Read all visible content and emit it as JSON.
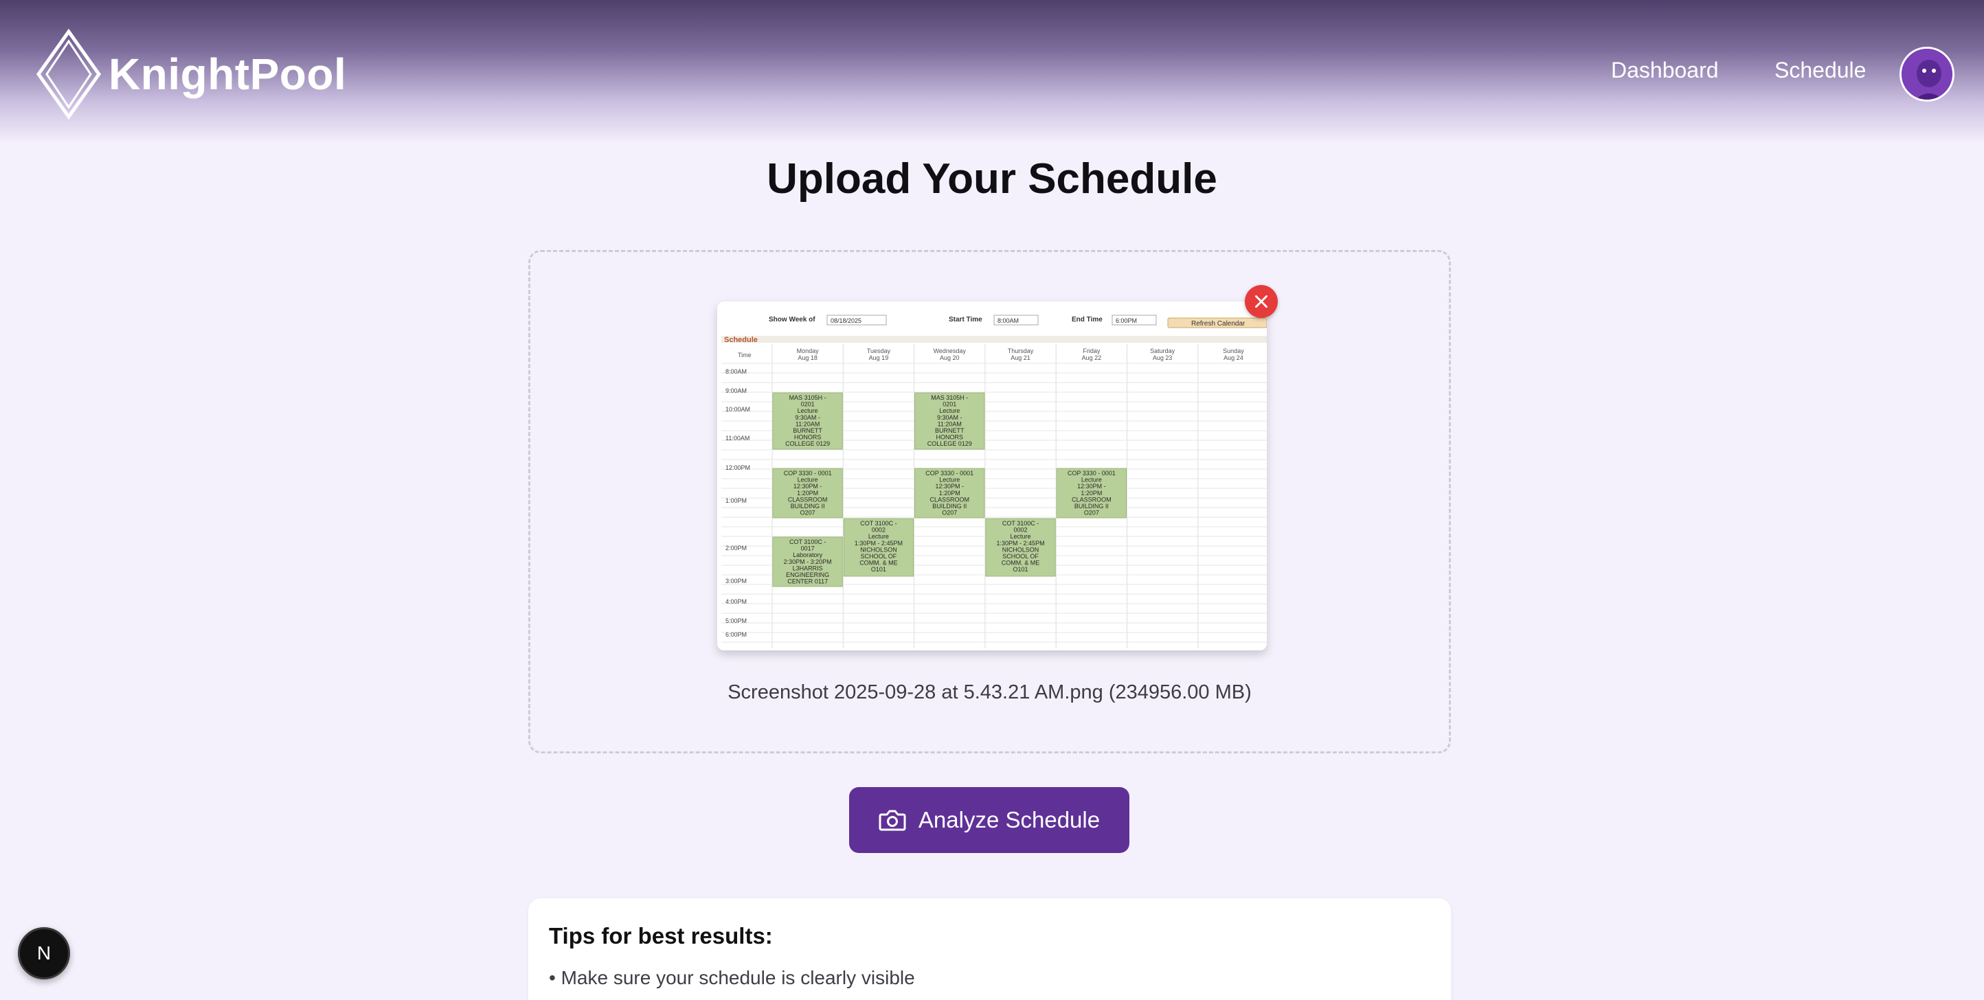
{
  "brand": {
    "name": "KnightPool",
    "logo_icon": "diamond-icon"
  },
  "nav": {
    "dashboard": "Dashboard",
    "schedule": "Schedule"
  },
  "page": {
    "title": "Upload Your Schedule"
  },
  "upload": {
    "file_name": "Screenshot 2025-09-28 at 5.43.21 AM.png (234956.00 MB)",
    "remove_icon": "close-icon"
  },
  "actions": {
    "analyze_label": "Analyze Schedule",
    "analyze_icon": "camera-icon"
  },
  "tips": {
    "title": "Tips for best results:",
    "items": [
      "• Make sure your schedule is clearly visible"
    ]
  },
  "preview_schedule": {
    "show_week_label": "Show Week of",
    "week_value": "08/18/2025",
    "start_time_label": "Start Time",
    "start_time_value": "8:00AM",
    "end_time_label": "End Time",
    "end_time_value": "6:00PM",
    "refresh_label": "Refresh Calendar",
    "section_label": "Schedule",
    "time_header": "Time",
    "days": [
      [
        "Monday",
        "Aug 18"
      ],
      [
        "Tuesday",
        "Aug 19"
      ],
      [
        "Wednesday",
        "Aug 20"
      ],
      [
        "Thursday",
        "Aug 21"
      ],
      [
        "Friday",
        "Aug 22"
      ],
      [
        "Saturday",
        "Aug 23"
      ],
      [
        "Sunday",
        "Aug 24"
      ]
    ],
    "times": [
      "8:00AM",
      "9:00AM",
      "10:00AM",
      "11:00AM",
      "12:00PM",
      "1:00PM",
      "2:00PM",
      "3:00PM",
      "4:00PM",
      "5:00PM",
      "6:00PM"
    ],
    "events": [
      {
        "day": 0,
        "lines": [
          "MAS 3105H -",
          "0201",
          "Lecture",
          "9:30AM -",
          "11:20AM",
          "BURNETT",
          "HONORS",
          "COLLEGE 0129"
        ]
      },
      {
        "day": 2,
        "lines": [
          "MAS 3105H -",
          "0201",
          "Lecture",
          "9:30AM -",
          "11:20AM",
          "BURNETT",
          "HONORS",
          "COLLEGE 0129"
        ]
      },
      {
        "day": 0,
        "lines": [
          "COP 3330 - 0001",
          "Lecture",
          "12:30PM -",
          "1:20PM",
          "CLASSROOM",
          "BUILDING II",
          "O207"
        ]
      },
      {
        "day": 2,
        "lines": [
          "COP 3330 - 0001",
          "Lecture",
          "12:30PM -",
          "1:20PM",
          "CLASSROOM",
          "BUILDING II",
          "O207"
        ]
      },
      {
        "day": 4,
        "lines": [
          "COP 3330 - 0001",
          "Lecture",
          "12:30PM -",
          "1:20PM",
          "CLASSROOM",
          "BUILDING II",
          "O207"
        ]
      },
      {
        "day": 1,
        "lines": [
          "COT 3100C -",
          "0002",
          "Lecture",
          "1:30PM - 2:45PM",
          "NICHOLSON",
          "SCHOOL OF",
          "COMM. & ME",
          "O101"
        ]
      },
      {
        "day": 3,
        "lines": [
          "COT 3100C -",
          "0002",
          "Lecture",
          "1:30PM - 2:45PM",
          "NICHOLSON",
          "SCHOOL OF",
          "COMM. & ME",
          "O101"
        ]
      },
      {
        "day": 0,
        "lines": [
          "COT 3100C -",
          "0017",
          "Laboratory",
          "2:30PM - 3:20PM",
          "L3HARRIS",
          "ENGINEERING",
          "CENTER 0117"
        ]
      }
    ]
  },
  "dev_badge": {
    "label": "N"
  },
  "colors": {
    "accent": "#5f3196",
    "remove": "#e53b3b",
    "event_fill": "#b7cf98"
  }
}
